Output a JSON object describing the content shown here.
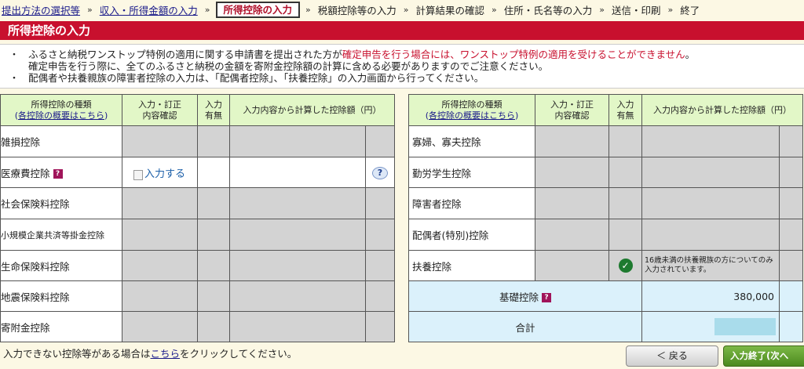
{
  "breadcrumb": [
    {
      "label": "提出方法の選択等",
      "state": "link"
    },
    {
      "label": "収入・所得金額の入力",
      "state": "link"
    },
    {
      "label": "所得控除の入力",
      "state": "current"
    },
    {
      "label": "税額控除等の入力",
      "state": "plain"
    },
    {
      "label": "計算結果の確認",
      "state": "plain"
    },
    {
      "label": "住所・氏名等の入力",
      "state": "plain"
    },
    {
      "label": "送信・印刷",
      "state": "plain"
    },
    {
      "label": "終了",
      "state": "plain"
    }
  ],
  "breadcrumb_sep": "»",
  "page_title": "所得控除の入力",
  "notes": {
    "bullet": "・",
    "line1_a": "ふるさと納税ワンストップ特例の適用に関する申請書を提出された方が",
    "line1_red": "確定申告を行う場合には、ワンストップ特例の適用を受けることができません",
    "line1_end": "。",
    "line2": "確定申告を行う際に、全てのふるさと納税の金額を寄附金控除額の計算に含める必要がありますのでご注意ください。",
    "line3": "配偶者や扶養親族の障害者控除の入力は、「配偶者控除」、「扶養控除」の入力画面から行ってください。"
  },
  "table_headers": {
    "type": "所得控除の種類",
    "type_sub_open": "(",
    "type_sub_link": "各控除の概要はこちら",
    "type_sub_close": ")",
    "input_confirm_1": "入力・訂正",
    "input_confirm_2": "内容確認",
    "input_status_1": "入力",
    "input_status_2": "有無",
    "amount": "入力内容から計算した控除額（円）"
  },
  "left_rows": [
    {
      "label": "雑損控除"
    },
    {
      "label": "医療費控除",
      "action": "入力する"
    },
    {
      "label": "社会保険料控除"
    },
    {
      "label": "小規模企業共済等掛金控除"
    },
    {
      "label": "生命保険料控除"
    },
    {
      "label": "地震保険料控除"
    },
    {
      "label": "寄附金控除"
    }
  ],
  "help_glyph": "?",
  "question_glyph": "?",
  "right_rows": [
    {
      "label": "寡婦、寡夫控除"
    },
    {
      "label": "勤労学生控除"
    },
    {
      "label": "障害者控除"
    },
    {
      "label": "配偶者(特別)控除"
    },
    {
      "label": "扶養控除",
      "note": "16歳未満の扶養親族の方についてのみ入力されています。",
      "checked": true
    }
  ],
  "basic_deduction": {
    "label": "基礎控除",
    "amount": "380,000"
  },
  "total": {
    "label": "合計",
    "amount": ""
  },
  "check_glyph": "✓",
  "footer": {
    "text_before": "入力できない控除等がある場合は",
    "link": "こちら",
    "text_after": "をクリックしてください。"
  },
  "buttons": {
    "back": "＜ 戻る",
    "finish": "入力終了(次へ"
  },
  "colors": {
    "accent": "#c8102e",
    "header_bg": "#e2f7c7",
    "summary_bg": "#dbf1fb",
    "finish_button": "#5e9e2a"
  }
}
